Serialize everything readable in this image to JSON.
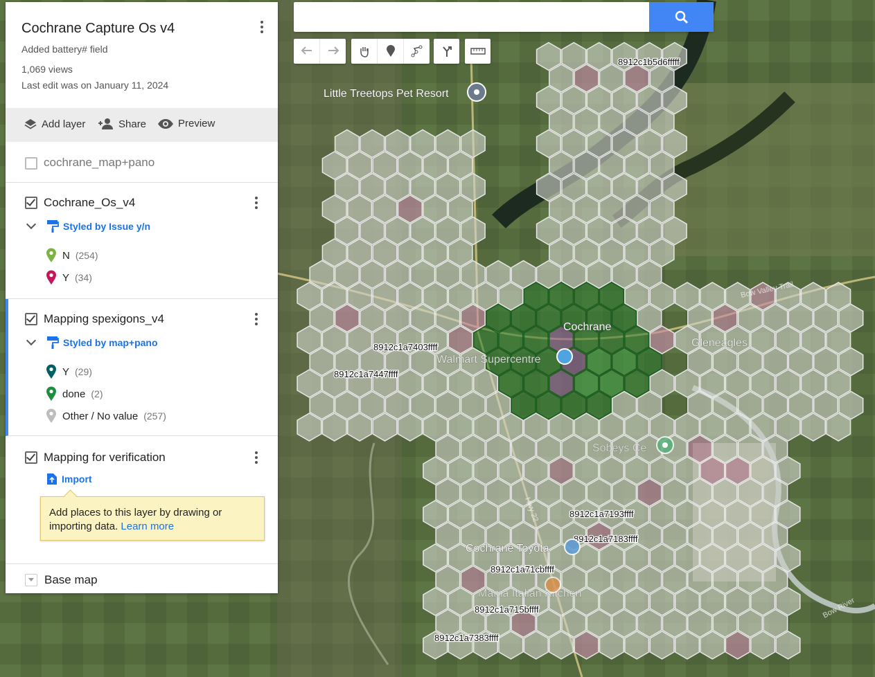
{
  "map_title": "Cochrane Capture Os v4",
  "map_description": "Added battery# field",
  "views": "1,069 views",
  "last_edit": "Last edit was on January 11, 2024",
  "actions": {
    "add_layer": "Add layer",
    "share": "Share",
    "preview": "Preview"
  },
  "layers": [
    {
      "name": "cochrane_map+pano",
      "checked": false
    },
    {
      "name": "Cochrane_Os_v4",
      "checked": true,
      "style": "Styled by Issue y/n",
      "legend": [
        {
          "label": "N",
          "count": "(254)",
          "color": "#7cb342"
        },
        {
          "label": "Y",
          "count": "(34)",
          "color": "#c2185b"
        }
      ]
    },
    {
      "name": "Mapping spexigons_v4",
      "checked": true,
      "style": "Styled by map+pano",
      "legend": [
        {
          "label": "Y",
          "count": "(29)",
          "color": "#006064"
        },
        {
          "label": "done",
          "count": "(2)",
          "color": "#1e8e3e"
        },
        {
          "label": "Other / No value",
          "count": "(257)",
          "color": "#bdbdbd"
        }
      ]
    },
    {
      "name": "Mapping for verification",
      "checked": true,
      "import_label": "Import",
      "tip_text": "Add places to this layer by drawing or importing data.",
      "tip_link": "Learn more"
    }
  ],
  "base_map": "Base map",
  "search": {
    "value": "",
    "placeholder": ""
  },
  "map_labels": {
    "places": [
      "Little Treetops Pet Resort",
      "Cochrane",
      "Walmart Supercentre",
      "Glenеagles",
      "Cochrane Toyota",
      "Mama Italian Kitchen",
      "Sobeys Ce",
      "Bow Valley Trail",
      "Bow River",
      "Hwy 22"
    ],
    "cells": [
      "8912c1b5d6fffff",
      "8912c1a7403ffff",
      "8912c1a7447ffff",
      "8912c1a7193ffff",
      "8912c1a7183ffff",
      "8912c1a71cbffff",
      "8912c1a715bffff",
      "8912c1a7383ffff"
    ]
  },
  "colors": {
    "accent": "#1a73e8",
    "search_button": "#4285f4",
    "hex_default": "#cfd2c8",
    "hex_issue": "#c48ca8",
    "hex_done": "#2e7d32",
    "hex_mapped": "#43a047"
  }
}
